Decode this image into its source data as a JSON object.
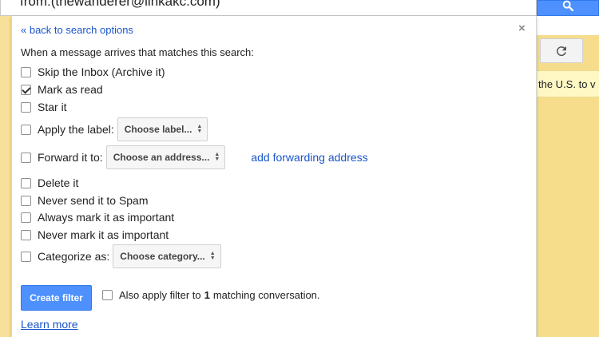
{
  "search": {
    "query": "from:(thewanderer@linkakc.com)",
    "button_icon": "search-icon"
  },
  "background": {
    "refresh_icon": "refresh-icon",
    "promo_text": "the U.S. to v"
  },
  "filter_panel": {
    "back_link": "« back to search options",
    "close_label": "×",
    "intro": "When a message arrives that matches this search:",
    "options": [
      {
        "label": "Skip the Inbox (Archive it)",
        "checked": false
      },
      {
        "label": "Mark as read",
        "checked": true
      },
      {
        "label": "Star it",
        "checked": false
      },
      {
        "label": "Apply the label:",
        "checked": false,
        "select": "Choose label..."
      },
      {
        "label": "Forward it to:",
        "checked": false,
        "select": "Choose an address...",
        "link": "add forwarding address"
      },
      {
        "label": "Delete it",
        "checked": false
      },
      {
        "label": "Never send it to Spam",
        "checked": false
      },
      {
        "label": "Always mark it as important",
        "checked": false
      },
      {
        "label": "Never mark it as important",
        "checked": false
      },
      {
        "label": "Categorize as:",
        "checked": false,
        "select": "Choose category..."
      }
    ],
    "create_button": "Create filter",
    "also_apply_prefix": "Also apply filter to",
    "also_apply_count": "1",
    "also_apply_suffix": "matching conversation.",
    "learn_more": "Learn more"
  },
  "colors": {
    "accent_blue": "#4d90fe",
    "link_blue": "#1a55c9",
    "background_yellow": "#f7e19a"
  }
}
